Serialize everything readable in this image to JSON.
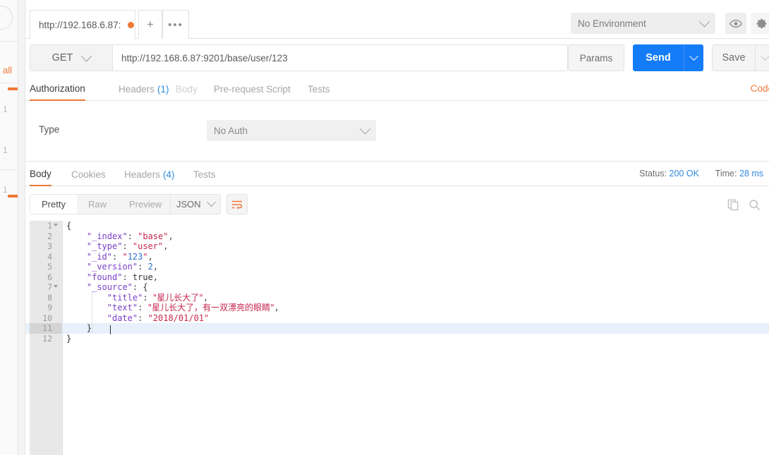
{
  "left_rail": {
    "label": "all",
    "items": [
      "1",
      "1",
      "1"
    ]
  },
  "tabbar": {
    "tabs": [
      {
        "title": "http://192.168.6.87:",
        "dirty": true
      }
    ],
    "add_label": "+",
    "more_label": "•••"
  },
  "header": {
    "environment": "No Environment",
    "eye_icon": "eye-icon",
    "gear_icon": "gear-icon"
  },
  "url_row": {
    "method": "GET",
    "url": "http://192.168.6.87:9201/base/user/123",
    "params_label": "Params",
    "send_label": "Send",
    "save_label": "Save"
  },
  "request_tabs": {
    "items": [
      {
        "label": "Authorization",
        "state": "active",
        "count": ""
      },
      {
        "label": "Headers",
        "state": "dim",
        "count": "(1)"
      },
      {
        "label": "Body",
        "state": "faint",
        "count": ""
      },
      {
        "label": "Pre-request Script",
        "state": "dim",
        "count": ""
      },
      {
        "label": "Tests",
        "state": "dim",
        "count": ""
      }
    ],
    "code_link": "Code"
  },
  "auth": {
    "type_label": "Type",
    "type_value": "No Auth"
  },
  "response_tabs": {
    "items": [
      {
        "label": "Body",
        "state": "active",
        "count": ""
      },
      {
        "label": "Cookies",
        "state": "dim",
        "count": ""
      },
      {
        "label": "Headers",
        "state": "dim",
        "count": "(4)"
      },
      {
        "label": "Tests",
        "state": "dim",
        "count": ""
      }
    ],
    "status_label": "Status:",
    "status_value": "200 OK",
    "time_label": "Time:",
    "time_value": "28 ms"
  },
  "response_toolbar": {
    "views": [
      {
        "label": "Pretty",
        "state": "active"
      },
      {
        "label": "Raw",
        "state": "dim"
      },
      {
        "label": "Preview",
        "state": "dim"
      }
    ],
    "format": "JSON",
    "wrap_icon": "word-wrap-icon",
    "copy_icon": "copy-icon",
    "search_icon": "search-icon"
  },
  "code": {
    "active_line": 11,
    "lines": [
      {
        "num": 1,
        "fold": true,
        "indent": 0,
        "tokens": [
          {
            "t": "{",
            "c": "b"
          }
        ]
      },
      {
        "num": 2,
        "fold": false,
        "indent": 4,
        "tokens": [
          {
            "t": "\"_index\"",
            "c": "k"
          },
          {
            "t": ": ",
            "c": "p"
          },
          {
            "t": "\"base\"",
            "c": "s"
          },
          {
            "t": ",",
            "c": "p"
          }
        ]
      },
      {
        "num": 3,
        "fold": false,
        "indent": 4,
        "tokens": [
          {
            "t": "\"_type\"",
            "c": "k"
          },
          {
            "t": ": ",
            "c": "p"
          },
          {
            "t": "\"user\"",
            "c": "s"
          },
          {
            "t": ",",
            "c": "p"
          }
        ]
      },
      {
        "num": 4,
        "fold": false,
        "indent": 4,
        "tokens": [
          {
            "t": "\"_id\"",
            "c": "k"
          },
          {
            "t": ": ",
            "c": "p"
          },
          {
            "t": "\"",
            "c": "s"
          },
          {
            "t": "123",
            "c": "n"
          },
          {
            "t": "\"",
            "c": "s"
          },
          {
            "t": ",",
            "c": "p"
          }
        ]
      },
      {
        "num": 5,
        "fold": false,
        "indent": 4,
        "tokens": [
          {
            "t": "\"_version\"",
            "c": "k"
          },
          {
            "t": ": ",
            "c": "p"
          },
          {
            "t": "2",
            "c": "n"
          },
          {
            "t": ",",
            "c": "p"
          }
        ]
      },
      {
        "num": 6,
        "fold": false,
        "indent": 4,
        "tokens": [
          {
            "t": "\"found\"",
            "c": "k"
          },
          {
            "t": ": ",
            "c": "p"
          },
          {
            "t": "true",
            "c": "b"
          },
          {
            "t": ",",
            "c": "p"
          }
        ]
      },
      {
        "num": 7,
        "fold": true,
        "indent": 4,
        "tokens": [
          {
            "t": "\"_source\"",
            "c": "k"
          },
          {
            "t": ": ",
            "c": "p"
          },
          {
            "t": "{",
            "c": "b"
          }
        ]
      },
      {
        "num": 8,
        "fold": false,
        "indent": 8,
        "tokens": [
          {
            "t": "\"title\"",
            "c": "k"
          },
          {
            "t": ": ",
            "c": "p"
          },
          {
            "t": "\"星儿长大了\"",
            "c": "cn"
          },
          {
            "t": ",",
            "c": "p"
          }
        ]
      },
      {
        "num": 9,
        "fold": false,
        "indent": 8,
        "tokens": [
          {
            "t": "\"text\"",
            "c": "k"
          },
          {
            "t": ": ",
            "c": "p"
          },
          {
            "t": "\"星儿长大了，有一双漂亮的眼睛\"",
            "c": "cn"
          },
          {
            "t": ",",
            "c": "p"
          }
        ]
      },
      {
        "num": 10,
        "fold": false,
        "indent": 8,
        "tokens": [
          {
            "t": "\"date\"",
            "c": "k"
          },
          {
            "t": ": ",
            "c": "p"
          },
          {
            "t": "\"2018/01/01\"",
            "c": "s"
          }
        ]
      },
      {
        "num": 11,
        "fold": false,
        "indent": 4,
        "tokens": [
          {
            "t": "}",
            "c": "b"
          }
        ]
      },
      {
        "num": 12,
        "fold": false,
        "indent": 0,
        "tokens": [
          {
            "t": "}",
            "c": "b"
          }
        ]
      }
    ]
  },
  "colors": {
    "accent": "#f07836",
    "send_blue": "#157cf7",
    "link_blue": "#2f8ae0",
    "key": "#7a3ec8",
    "string": "#c7254e",
    "number": "#2f6fd0"
  }
}
